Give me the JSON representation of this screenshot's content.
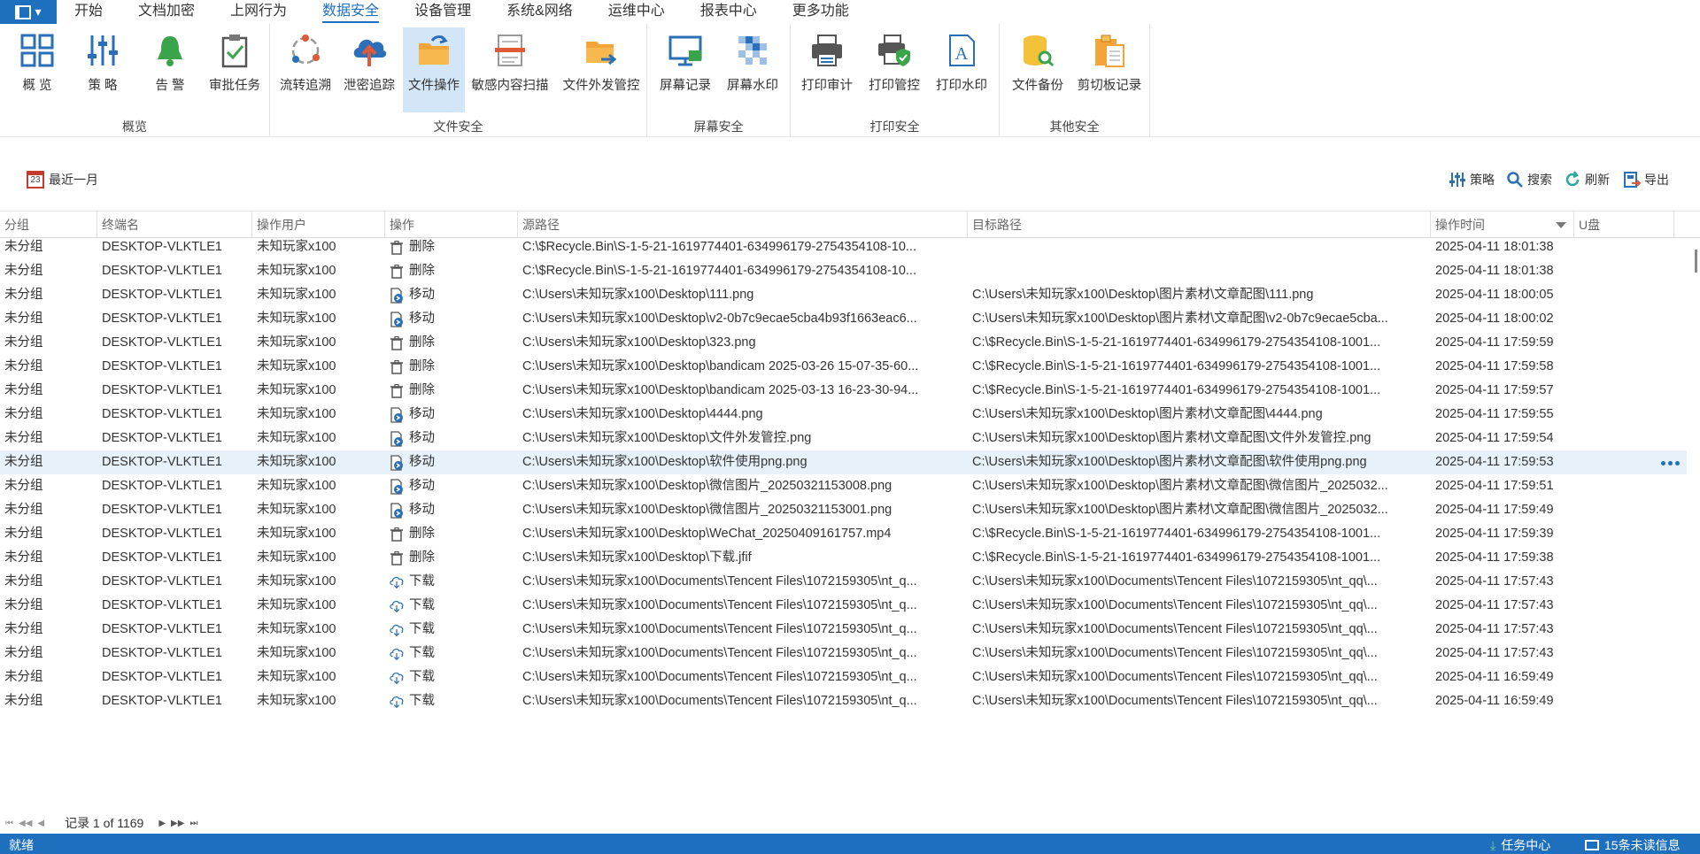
{
  "menu": {
    "app_button": "",
    "items": [
      "开始",
      "文档加密",
      "上网行为",
      "数据安全",
      "设备管理",
      "系统&网络",
      "运维中心",
      "报表中心",
      "更多功能"
    ],
    "active_index": 3
  },
  "ribbon": {
    "groups": [
      {
        "label": "概览",
        "buttons": [
          "概 览",
          "策 略",
          "告 警",
          "审批任务"
        ]
      },
      {
        "label": "文件安全",
        "buttons": [
          "流转追溯",
          "泄密追踪",
          "文件操作",
          "敏感内容扫描",
          "文件外发管控"
        ]
      },
      {
        "label": "屏幕安全",
        "buttons": [
          "屏幕记录",
          "屏幕水印"
        ]
      },
      {
        "label": "打印安全",
        "buttons": [
          "打印审计",
          "打印管控",
          "打印水印"
        ]
      },
      {
        "label": "其他安全",
        "buttons": [
          "文件备份",
          "剪切板记录"
        ]
      }
    ],
    "selected": "文件操作"
  },
  "toolbar": {
    "date_range": "最近一月",
    "calendar_day": "23",
    "strategy": "策略",
    "search": "搜索",
    "refresh": "刷新",
    "export": "导出"
  },
  "grid": {
    "columns": [
      "分组",
      "终端名",
      "操作用户",
      "操作",
      "源路径",
      "目标路径",
      "操作时间",
      "U盘"
    ],
    "selected_row": 9,
    "rows": [
      {
        "group": "未分组",
        "terminal": "DESKTOP-VLKTLE1",
        "user": "未知玩家x100",
        "op": "删除",
        "op_icon": "trash-icon",
        "src": "C:\\$Recycle.Bin\\S-1-5-21-1619774401-634996179-2754354108-10...",
        "dst": "",
        "time": "2025-04-11 18:01:38"
      },
      {
        "group": "未分组",
        "terminal": "DESKTOP-VLKTLE1",
        "user": "未知玩家x100",
        "op": "删除",
        "op_icon": "trash-icon",
        "src": "C:\\$Recycle.Bin\\S-1-5-21-1619774401-634996179-2754354108-10...",
        "dst": "",
        "time": "2025-04-11 18:01:38"
      },
      {
        "group": "未分组",
        "terminal": "DESKTOP-VLKTLE1",
        "user": "未知玩家x100",
        "op": "移动",
        "op_icon": "move-file-icon",
        "src": "C:\\Users\\未知玩家x100\\Desktop\\111.png",
        "dst": "C:\\Users\\未知玩家x100\\Desktop\\图片素材\\文章配图\\111.png",
        "time": "2025-04-11 18:00:05"
      },
      {
        "group": "未分组",
        "terminal": "DESKTOP-VLKTLE1",
        "user": "未知玩家x100",
        "op": "移动",
        "op_icon": "move-file-icon",
        "src": "C:\\Users\\未知玩家x100\\Desktop\\v2-0b7c9ecae5cba4b93f1663eac6...",
        "dst": "C:\\Users\\未知玩家x100\\Desktop\\图片素材\\文章配图\\v2-0b7c9ecae5cba...",
        "time": "2025-04-11 18:00:02"
      },
      {
        "group": "未分组",
        "terminal": "DESKTOP-VLKTLE1",
        "user": "未知玩家x100",
        "op": "删除",
        "op_icon": "trash-icon",
        "src": "C:\\Users\\未知玩家x100\\Desktop\\323.png",
        "dst": "C:\\$Recycle.Bin\\S-1-5-21-1619774401-634996179-2754354108-1001...",
        "time": "2025-04-11 17:59:59"
      },
      {
        "group": "未分组",
        "terminal": "DESKTOP-VLKTLE1",
        "user": "未知玩家x100",
        "op": "删除",
        "op_icon": "trash-icon",
        "src": "C:\\Users\\未知玩家x100\\Desktop\\bandicam 2025-03-26 15-07-35-60...",
        "dst": "C:\\$Recycle.Bin\\S-1-5-21-1619774401-634996179-2754354108-1001...",
        "time": "2025-04-11 17:59:58"
      },
      {
        "group": "未分组",
        "terminal": "DESKTOP-VLKTLE1",
        "user": "未知玩家x100",
        "op": "删除",
        "op_icon": "trash-icon",
        "src": "C:\\Users\\未知玩家x100\\Desktop\\bandicam 2025-03-13 16-23-30-94...",
        "dst": "C:\\$Recycle.Bin\\S-1-5-21-1619774401-634996179-2754354108-1001...",
        "time": "2025-04-11 17:59:57"
      },
      {
        "group": "未分组",
        "terminal": "DESKTOP-VLKTLE1",
        "user": "未知玩家x100",
        "op": "移动",
        "op_icon": "move-file-icon",
        "src": "C:\\Users\\未知玩家x100\\Desktop\\4444.png",
        "dst": "C:\\Users\\未知玩家x100\\Desktop\\图片素材\\文章配图\\4444.png",
        "time": "2025-04-11 17:59:55"
      },
      {
        "group": "未分组",
        "terminal": "DESKTOP-VLKTLE1",
        "user": "未知玩家x100",
        "op": "移动",
        "op_icon": "move-file-icon",
        "src": "C:\\Users\\未知玩家x100\\Desktop\\文件外发管控.png",
        "dst": "C:\\Users\\未知玩家x100\\Desktop\\图片素材\\文章配图\\文件外发管控.png",
        "time": "2025-04-11 17:59:54"
      },
      {
        "group": "未分组",
        "terminal": "DESKTOP-VLKTLE1",
        "user": "未知玩家x100",
        "op": "移动",
        "op_icon": "move-file-icon",
        "src": "C:\\Users\\未知玩家x100\\Desktop\\软件使用png.png",
        "dst": "C:\\Users\\未知玩家x100\\Desktop\\图片素材\\文章配图\\软件使用png.png",
        "time": "2025-04-11 17:59:53"
      },
      {
        "group": "未分组",
        "terminal": "DESKTOP-VLKTLE1",
        "user": "未知玩家x100",
        "op": "移动",
        "op_icon": "move-file-icon",
        "src": "C:\\Users\\未知玩家x100\\Desktop\\微信图片_20250321153008.png",
        "dst": "C:\\Users\\未知玩家x100\\Desktop\\图片素材\\文章配图\\微信图片_2025032...",
        "time": "2025-04-11 17:59:51"
      },
      {
        "group": "未分组",
        "terminal": "DESKTOP-VLKTLE1",
        "user": "未知玩家x100",
        "op": "移动",
        "op_icon": "move-file-icon",
        "src": "C:\\Users\\未知玩家x100\\Desktop\\微信图片_20250321153001.png",
        "dst": "C:\\Users\\未知玩家x100\\Desktop\\图片素材\\文章配图\\微信图片_2025032...",
        "time": "2025-04-11 17:59:49"
      },
      {
        "group": "未分组",
        "terminal": "DESKTOP-VLKTLE1",
        "user": "未知玩家x100",
        "op": "删除",
        "op_icon": "trash-icon",
        "src": "C:\\Users\\未知玩家x100\\Desktop\\WeChat_20250409161757.mp4",
        "dst": "C:\\$Recycle.Bin\\S-1-5-21-1619774401-634996179-2754354108-1001...",
        "time": "2025-04-11 17:59:39"
      },
      {
        "group": "未分组",
        "terminal": "DESKTOP-VLKTLE1",
        "user": "未知玩家x100",
        "op": "删除",
        "op_icon": "trash-icon",
        "src": "C:\\Users\\未知玩家x100\\Desktop\\下载.jfif",
        "dst": "C:\\$Recycle.Bin\\S-1-5-21-1619774401-634996179-2754354108-1001...",
        "time": "2025-04-11 17:59:38"
      },
      {
        "group": "未分组",
        "terminal": "DESKTOP-VLKTLE1",
        "user": "未知玩家x100",
        "op": "下载",
        "op_icon": "cloud-download-icon",
        "src": "C:\\Users\\未知玩家x100\\Documents\\Tencent Files\\1072159305\\nt_q...",
        "dst": "C:\\Users\\未知玩家x100\\Documents\\Tencent Files\\1072159305\\nt_qq\\...",
        "time": "2025-04-11 17:57:43"
      },
      {
        "group": "未分组",
        "terminal": "DESKTOP-VLKTLE1",
        "user": "未知玩家x100",
        "op": "下载",
        "op_icon": "cloud-download-icon",
        "src": "C:\\Users\\未知玩家x100\\Documents\\Tencent Files\\1072159305\\nt_q...",
        "dst": "C:\\Users\\未知玩家x100\\Documents\\Tencent Files\\1072159305\\nt_qq\\...",
        "time": "2025-04-11 17:57:43"
      },
      {
        "group": "未分组",
        "terminal": "DESKTOP-VLKTLE1",
        "user": "未知玩家x100",
        "op": "下载",
        "op_icon": "cloud-download-icon",
        "src": "C:\\Users\\未知玩家x100\\Documents\\Tencent Files\\1072159305\\nt_q...",
        "dst": "C:\\Users\\未知玩家x100\\Documents\\Tencent Files\\1072159305\\nt_qq\\...",
        "time": "2025-04-11 17:57:43"
      },
      {
        "group": "未分组",
        "terminal": "DESKTOP-VLKTLE1",
        "user": "未知玩家x100",
        "op": "下载",
        "op_icon": "cloud-download-icon",
        "src": "C:\\Users\\未知玩家x100\\Documents\\Tencent Files\\1072159305\\nt_q...",
        "dst": "C:\\Users\\未知玩家x100\\Documents\\Tencent Files\\1072159305\\nt_qq\\...",
        "time": "2025-04-11 17:57:43"
      },
      {
        "group": "未分组",
        "terminal": "DESKTOP-VLKTLE1",
        "user": "未知玩家x100",
        "op": "下载",
        "op_icon": "cloud-download-icon",
        "src": "C:\\Users\\未知玩家x100\\Documents\\Tencent Files\\1072159305\\nt_q...",
        "dst": "C:\\Users\\未知玩家x100\\Documents\\Tencent Files\\1072159305\\nt_qq\\...",
        "time": "2025-04-11 16:59:49"
      },
      {
        "group": "未分组",
        "terminal": "DESKTOP-VLKTLE1",
        "user": "未知玩家x100",
        "op": "下载",
        "op_icon": "cloud-download-icon",
        "src": "C:\\Users\\未知玩家x100\\Documents\\Tencent Files\\1072159305\\nt_q...",
        "dst": "C:\\Users\\未知玩家x100\\Documents\\Tencent Files\\1072159305\\nt_qq\\...",
        "time": "2025-04-11 16:59:49"
      }
    ]
  },
  "pager": {
    "record_text": "记录 1 of 1169"
  },
  "status": {
    "ready": "就绪",
    "task_center": "任务中心",
    "unread": "15条未读信息"
  },
  "colors": {
    "accent": "#1f6fbf",
    "selected_row": "#e6f1f9",
    "ribbon_selected": "#d3e6f7"
  }
}
